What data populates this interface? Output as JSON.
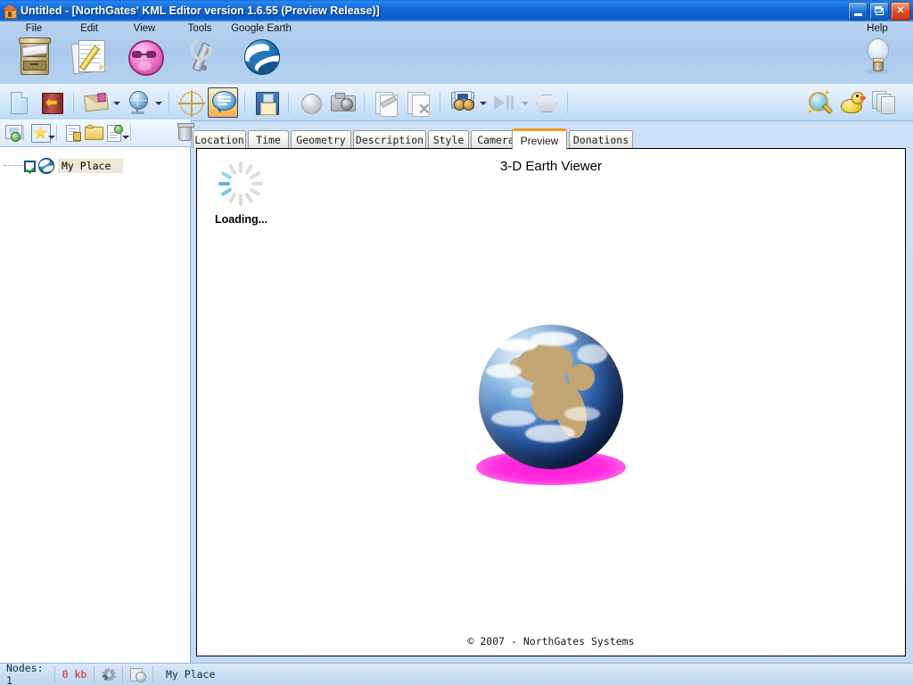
{
  "window": {
    "title": "Untitled - [NorthGates' KML Editor version 1.6.55 (Preview Release)]",
    "icon": "house-icon",
    "controls": {
      "minimize": "minimize-button",
      "restore": "restore-button",
      "close": "close-button"
    }
  },
  "menu": {
    "items": [
      {
        "label": "File",
        "icon": "filing-cabinet-icon"
      },
      {
        "label": "Edit",
        "icon": "notepad-pencil-icon"
      },
      {
        "label": "View",
        "icon": "pink-face-sunglasses-icon"
      },
      {
        "label": "Tools",
        "icon": "wrench-icon"
      },
      {
        "label": "Google Earth",
        "icon": "google-earth-globe-icon"
      }
    ],
    "help": {
      "label": "Help",
      "icon": "lightbulb-icon"
    }
  },
  "toolbar": {
    "buttons": [
      {
        "name": "new-document",
        "icon": "blank-page-icon",
        "enabled": true,
        "selected": false
      },
      {
        "name": "open-file",
        "icon": "open-book-arrow-icon",
        "enabled": true,
        "selected": false
      },
      {
        "name": "send-mail",
        "icon": "envelope-icon",
        "enabled": true,
        "selected": false,
        "dropdown": true
      },
      {
        "name": "view-globe",
        "icon": "globe-stand-icon",
        "enabled": true,
        "selected": false,
        "dropdown": true
      },
      {
        "name": "crosshair-tool",
        "icon": "crosshair-target-icon",
        "enabled": true,
        "selected": false
      },
      {
        "name": "description",
        "icon": "speech-bubble-icon",
        "enabled": true,
        "selected": true
      },
      {
        "name": "save-file",
        "icon": "floppy-disk-icon",
        "enabled": true,
        "selected": false
      },
      {
        "name": "sphere-tool",
        "icon": "sphere-icon",
        "enabled": false,
        "selected": false
      },
      {
        "name": "snapshot",
        "icon": "camera-icon",
        "enabled": false,
        "selected": false
      },
      {
        "name": "edit-pages",
        "icon": "pages-pen-icon",
        "enabled": false,
        "selected": false
      },
      {
        "name": "delete-pages",
        "icon": "pages-delete-icon",
        "enabled": false,
        "selected": false
      },
      {
        "name": "projector",
        "icon": "projector-icon",
        "enabled": true,
        "selected": false,
        "dropdown": true
      },
      {
        "name": "play-pause",
        "icon": "play-pause-icon",
        "enabled": false,
        "selected": false,
        "dropdown": true
      },
      {
        "name": "polygon-tool",
        "icon": "hexagon-icon",
        "enabled": false,
        "selected": false
      }
    ],
    "right_buttons": [
      {
        "name": "zoom-tool",
        "icon": "magnifier-sparkle-icon"
      },
      {
        "name": "rubber-duck",
        "icon": "rubber-duck-icon"
      },
      {
        "name": "window-stack",
        "icon": "stacked-windows-icon"
      }
    ]
  },
  "tree_toolbar": {
    "buttons": [
      {
        "name": "add-view",
        "icon": "globe-frame-icon"
      },
      {
        "name": "add-placemark",
        "icon": "star-placemark-icon",
        "dropdown": true
      },
      {
        "name": "add-locked",
        "icon": "folder-lock-icon"
      },
      {
        "name": "new-folder",
        "icon": "new-folder-icon"
      },
      {
        "name": "add-overlay",
        "icon": "document-pin-icon",
        "dropdown": true
      },
      {
        "name": "delete-node",
        "icon": "trash-can-icon"
      }
    ]
  },
  "tree": {
    "nodes": [
      {
        "label": "My Place",
        "checked": true,
        "selected": true,
        "icon": "globe-node-icon"
      }
    ]
  },
  "tabs": [
    {
      "label": "Location",
      "active": false,
      "width": 60
    },
    {
      "label": "Time",
      "active": false,
      "width": 46
    },
    {
      "label": "Geometry",
      "active": false,
      "width": 68
    },
    {
      "label": "Description",
      "active": false,
      "width": 82
    },
    {
      "label": "Style",
      "active": false,
      "width": 46
    },
    {
      "label": "Camera",
      "active": false,
      "width": 56
    },
    {
      "label": "Preview",
      "active": true,
      "width": 58
    },
    {
      "label": "Donations",
      "active": false,
      "width": 72
    }
  ],
  "preview": {
    "title": "3-D Earth Viewer",
    "loading_label": "Loading...",
    "footer": "© 2007 - NorthGates Systems",
    "globe_icon": "earth-globe-image",
    "shadow_color": "#ff18d8"
  },
  "statusbar": {
    "nodes_label": "Nodes: 1",
    "size_label": "0 kb",
    "size_color": "#d01a1a",
    "icons": [
      {
        "name": "status-spinner-icon"
      },
      {
        "name": "status-webpage-icon"
      }
    ],
    "selection_label": "My Place"
  },
  "colors": {
    "titlebar_blue": "#1268d8",
    "active_tab_accent": "#f19a1b",
    "selection_beige": "#ece9d8",
    "toolbar_highlight": "#fdd07a"
  }
}
